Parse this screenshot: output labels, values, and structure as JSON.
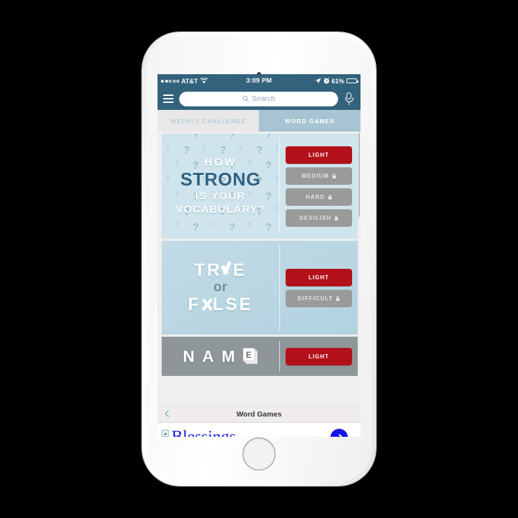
{
  "device": {
    "kind": "smartphone",
    "body_color": "#f7f7f7",
    "home_button_name": "home-button"
  },
  "statusbar": {
    "carrier": "AT&T",
    "signal_filled_dots": 2,
    "signal_hollow_dots": 3,
    "wifi_icon": "wifi-icon",
    "time": "3:09 PM",
    "location_icon": "location-arrow-icon",
    "alarm_icon": "alarm-clock-icon",
    "battery_percent": "61%",
    "battery_level": 61,
    "battery_icon": "battery-icon"
  },
  "navbar": {
    "menu_icon": "hamburger-menu-icon",
    "search_icon": "search-icon",
    "search_placeholder": "Search",
    "search_value": "",
    "mic_icon": "microphone-icon",
    "background": "#33627c"
  },
  "tabs": [
    {
      "label": "WEEKLY CHALLENGE",
      "active": false
    },
    {
      "label": "WORD GAMES",
      "active": true
    }
  ],
  "colors": {
    "header_blue": "#33627c",
    "tab_active": "#a6c4d2",
    "tab_inactive": "#e8e8e8",
    "button_red": "#b3111a",
    "button_locked_gray": "#9a9a9a",
    "card_vocab_bg": "#cfe4ec",
    "card_truefalse_bg": "#b2d2e0",
    "card_name_bg": "#8f9699",
    "ad_blue": "#1414e6"
  },
  "games": [
    {
      "id": "vocabulary-strength",
      "title_lines": [
        "HOW",
        "STRONG",
        "IS YOUR",
        "VOCABULARY?"
      ],
      "background_pattern": "question-marks",
      "levels": [
        {
          "label": "LIGHT",
          "state": "unlocked",
          "style": "red"
        },
        {
          "label": "MEDIUM",
          "state": "locked",
          "style": "gray",
          "lock_icon": "lock-icon"
        },
        {
          "label": "HARD",
          "state": "locked",
          "style": "gray",
          "lock_icon": "lock-icon"
        },
        {
          "label": "DEVILISH",
          "state": "locked",
          "style": "gray",
          "lock_icon": "lock-icon"
        }
      ]
    },
    {
      "id": "true-or-false",
      "title_lines": [
        "TR✓E",
        "or",
        "F✕LSE"
      ],
      "title_plain": "TRUE or FALSE",
      "levels": [
        {
          "label": "LIGHT",
          "state": "unlocked",
          "style": "red"
        },
        {
          "label": "DIFFICULT",
          "state": "locked",
          "style": "gray",
          "lock_icon": "lock-icon"
        }
      ]
    },
    {
      "id": "name-that-thing",
      "title_plain": "NAME",
      "letters": [
        "N",
        "A",
        "M"
      ],
      "card_letter": "E",
      "card_icon": "flashcard-stack-icon",
      "levels": [
        {
          "label": "LIGHT",
          "state": "unlocked",
          "style": "red"
        }
      ]
    }
  ],
  "toolbar": {
    "back_icon": "back-chevron-icon",
    "title": "Word Games"
  },
  "ad": {
    "adchoices_icon": "adchoices-icon",
    "close_icon": "close-x-icon",
    "headline": "Blessings",
    "cta_icon": "chevron-right-icon"
  }
}
